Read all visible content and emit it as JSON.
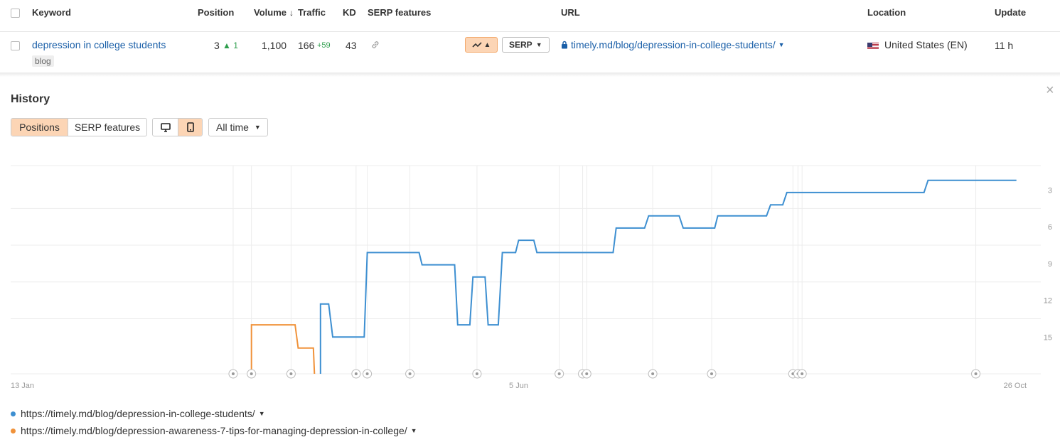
{
  "table": {
    "headers": {
      "keyword": "Keyword",
      "position": "Position",
      "volume": "Volume",
      "volume_sort_icon": "arrow-down-icon",
      "traffic": "Traffic",
      "kd": "KD",
      "serp_features": "SERP features",
      "url": "URL",
      "location": "Location",
      "update": "Update"
    },
    "row": {
      "keyword": "depression in college students",
      "tag": "blog",
      "position": "3",
      "position_change": "1",
      "volume": "1,100",
      "traffic": "166",
      "traffic_change": "+59",
      "kd": "43",
      "serp_button": "SERP",
      "url": "timely.md/blog/depression-in-college-students/",
      "location": "United States (EN)",
      "update": "11 h"
    }
  },
  "history": {
    "title": "History",
    "tabs": [
      "Positions",
      "SERP features"
    ],
    "active_tab": "Positions",
    "device_active": "mobile",
    "time_range": "All time"
  },
  "chart_data": {
    "type": "line",
    "x_axis_labels": [
      "13 Jan",
      "5 Jun",
      "26 Oct"
    ],
    "y_ticks": [
      3,
      6,
      9,
      12,
      15
    ],
    "ylim": [
      1,
      18
    ],
    "y_inverted": true,
    "grid": true,
    "series": [
      {
        "name": "https://timely.md/blog/depression-in-college-students/",
        "color": "#3d8fd1",
        "points": [
          [
            0.305,
            18
          ],
          [
            0.305,
            12.3
          ],
          [
            0.313,
            12.3
          ],
          [
            0.317,
            15
          ],
          [
            0.348,
            15
          ],
          [
            0.351,
            8.1
          ],
          [
            0.402,
            8.1
          ],
          [
            0.405,
            9.1
          ],
          [
            0.437,
            9.1
          ],
          [
            0.44,
            14
          ],
          [
            0.452,
            14
          ],
          [
            0.455,
            10.1
          ],
          [
            0.467,
            10.1
          ],
          [
            0.47,
            14
          ],
          [
            0.48,
            14
          ],
          [
            0.484,
            8.1
          ],
          [
            0.497,
            8.1
          ],
          [
            0.5,
            7.1
          ],
          [
            0.515,
            7.1
          ],
          [
            0.518,
            8.1
          ],
          [
            0.593,
            8.1
          ],
          [
            0.596,
            6.1
          ],
          [
            0.624,
            6.1
          ],
          [
            0.628,
            5.1
          ],
          [
            0.658,
            5.1
          ],
          [
            0.662,
            6.1
          ],
          [
            0.693,
            6.1
          ],
          [
            0.696,
            5.1
          ],
          [
            0.744,
            5.1
          ],
          [
            0.748,
            4.2
          ],
          [
            0.76,
            4.2
          ],
          [
            0.764,
            3.2
          ],
          [
            0.899,
            3.2
          ],
          [
            0.903,
            2.2
          ],
          [
            0.99,
            2.2
          ]
        ]
      },
      {
        "name": "https://timely.md/blog/depression-awareness-7-tips-for-managing-depression-in-college/",
        "color": "#f0923a",
        "points": [
          [
            0.237,
            18
          ],
          [
            0.237,
            14
          ],
          [
            0.28,
            14
          ],
          [
            0.283,
            15.9
          ],
          [
            0.298,
            15.9
          ],
          [
            0.299,
            18
          ]
        ]
      }
    ],
    "annotation_markers": [
      0.219,
      0.237,
      0.276,
      0.34,
      0.351,
      0.393,
      0.459,
      0.54,
      0.563,
      0.567,
      0.632,
      0.69,
      0.77,
      0.775,
      0.779,
      0.95
    ]
  },
  "icons": {
    "lock": "lock-icon",
    "flag": "us-flag-icon",
    "link": "link-icon",
    "close": "close-icon",
    "desktop": "desktop-icon",
    "mobile": "mobile-icon",
    "trend": "trend-icon"
  }
}
